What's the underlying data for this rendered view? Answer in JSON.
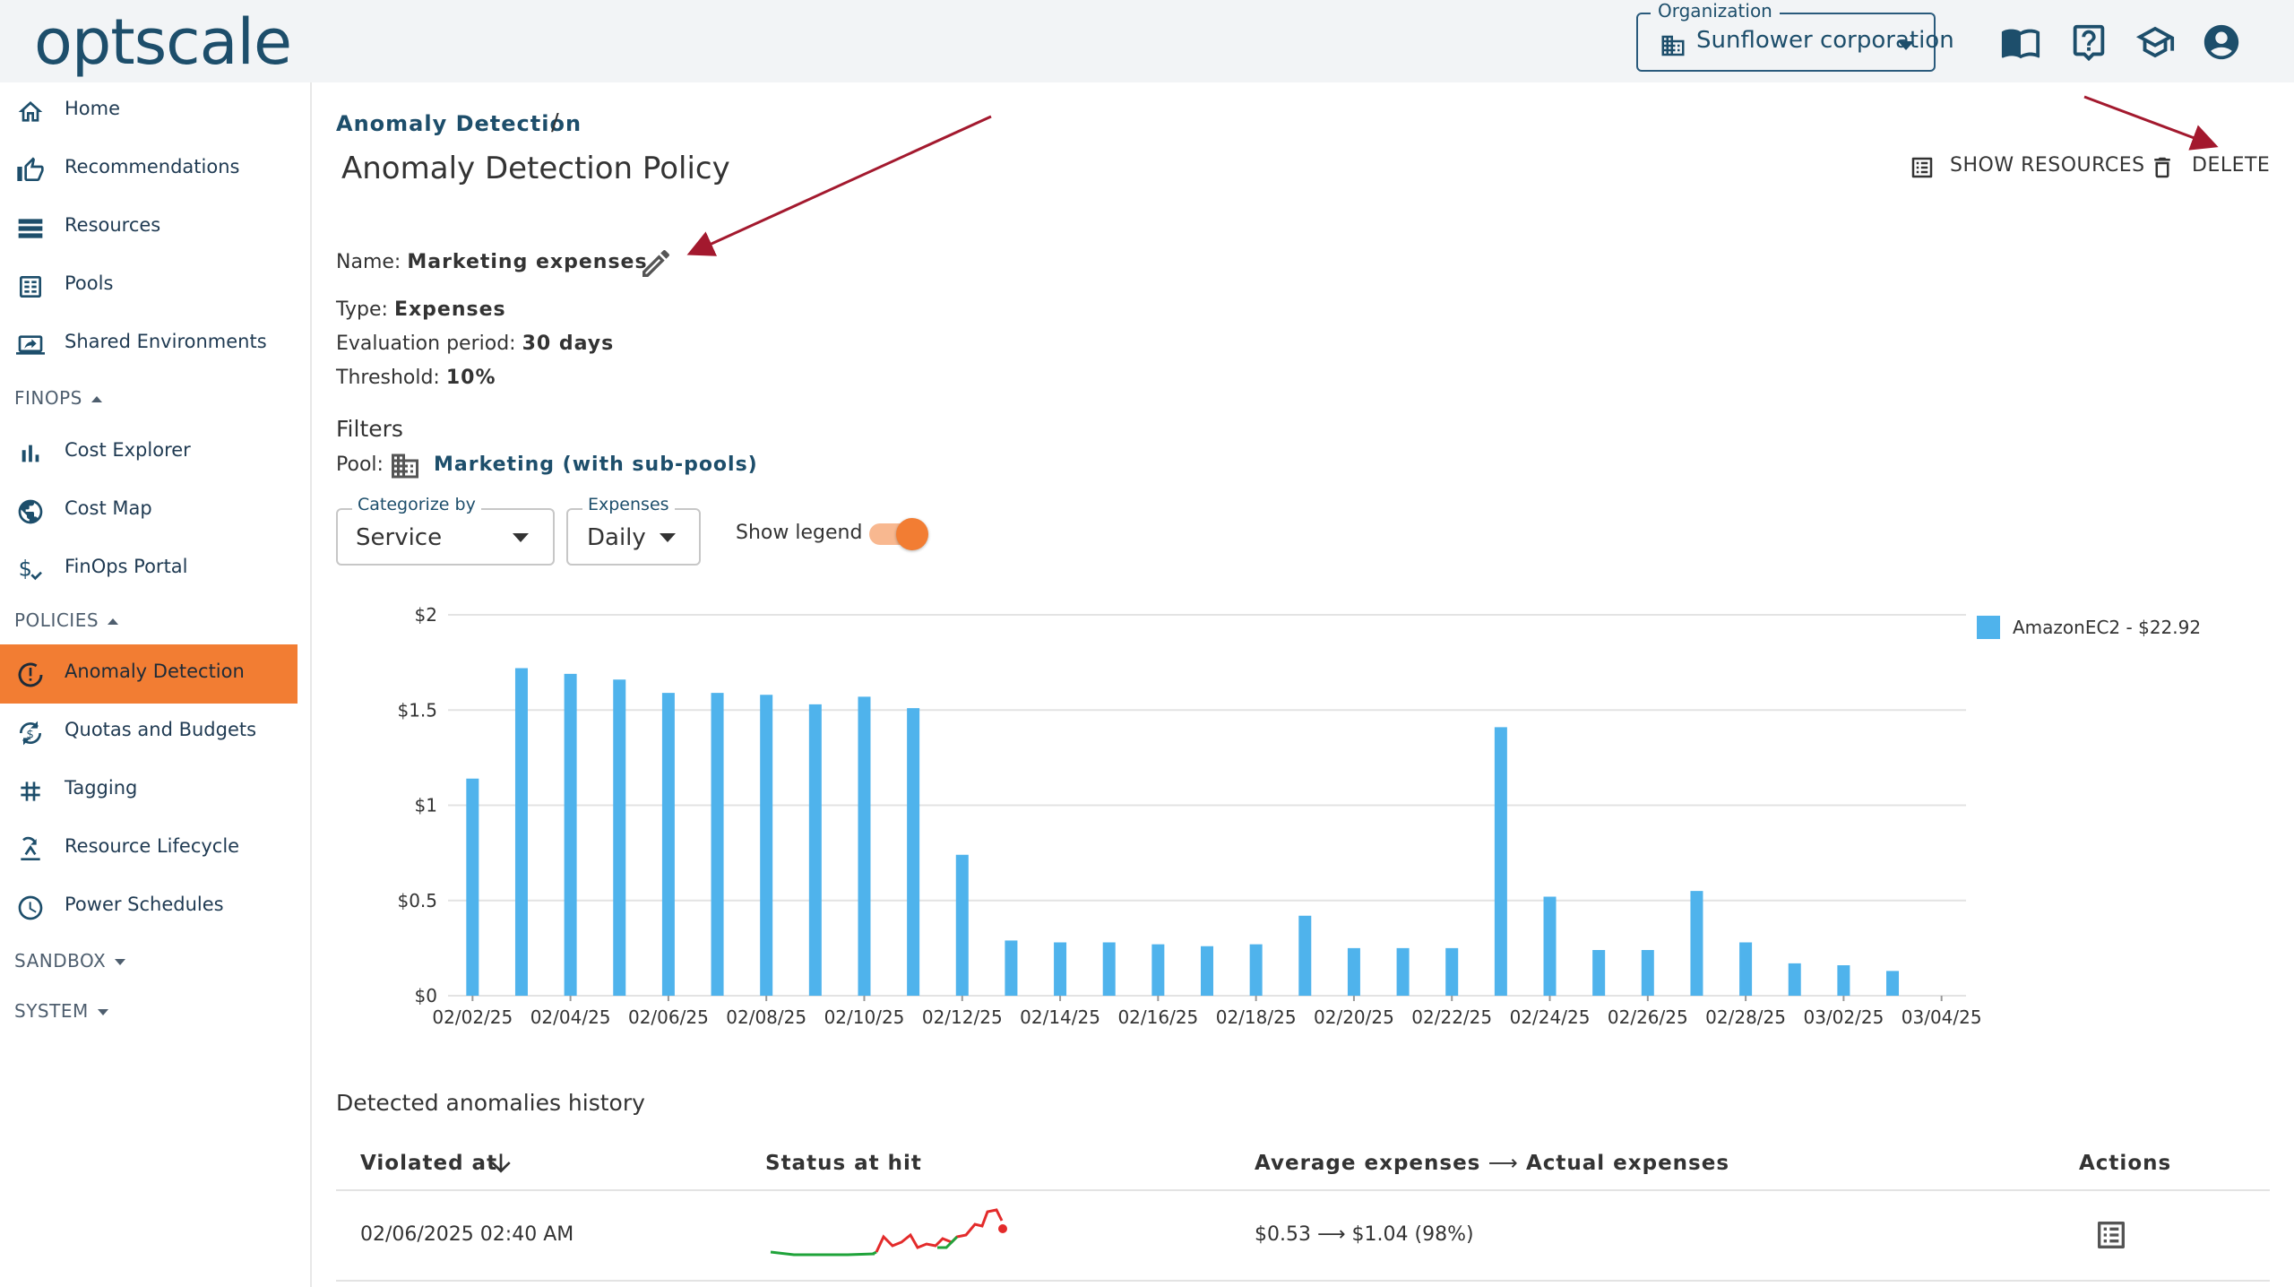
{
  "header": {
    "logo_text": "optscale",
    "org_label": "Organization",
    "org_value": "Sunflower corporation",
    "icons": [
      "documentation-icon",
      "help-icon",
      "training-icon",
      "profile-icon"
    ]
  },
  "sidebar": {
    "items_top": [
      {
        "label": "Home",
        "icon": "home-icon"
      },
      {
        "label": "Recommendations",
        "icon": "thumb-up-icon"
      },
      {
        "label": "Resources",
        "icon": "resources-icon"
      },
      {
        "label": "Pools",
        "icon": "pools-icon"
      },
      {
        "label": "Shared Environments",
        "icon": "shared-env-icon"
      }
    ],
    "finops_label": "FINOPS",
    "finops_items": [
      {
        "label": "Cost Explorer",
        "icon": "bar-chart-icon"
      },
      {
        "label": "Cost Map",
        "icon": "globe-icon"
      },
      {
        "label": "FinOps Portal",
        "icon": "dollar-icon"
      }
    ],
    "policies_label": "POLICIES",
    "policies_items": [
      {
        "label": "Anomaly Detection",
        "icon": "anomaly-icon"
      },
      {
        "label": "Quotas and Budgets",
        "icon": "budget-icon"
      },
      {
        "label": "Tagging",
        "icon": "hash-icon"
      },
      {
        "label": "Resource Lifecycle",
        "icon": "lifecycle-icon"
      },
      {
        "label": "Power Schedules",
        "icon": "clock-icon"
      }
    ],
    "sandbox_label": "SANDBOX",
    "system_label": "SYSTEM"
  },
  "breadcrumb": {
    "link": "Anomaly Detection",
    "sep": "/"
  },
  "page_title": "Anomaly Detection Policy",
  "actions": {
    "show_resources": "SHOW RESOURCES",
    "delete": "DELETE"
  },
  "policy": {
    "name_label": "Name:",
    "name_value": "Marketing expenses",
    "type_label": "Type:",
    "type_value": "Expenses",
    "period_label": "Evaluation period:",
    "period_value": "30 days",
    "threshold_label": "Threshold:",
    "threshold_value": "10%"
  },
  "filters": {
    "title": "Filters",
    "pool_label": "Pool:",
    "pool_value": "Marketing (with sub-pools)"
  },
  "controls": {
    "categorize_label": "Categorize by",
    "categorize_value": "Service",
    "expenses_label": "Expenses",
    "expenses_value": "Daily",
    "legend_label": "Show legend",
    "legend_on": true
  },
  "chart_data": {
    "type": "bar",
    "categories": [
      "02/02/25",
      "02/03/25",
      "02/04/25",
      "02/05/25",
      "02/06/25",
      "02/07/25",
      "02/08/25",
      "02/09/25",
      "02/10/25",
      "02/11/25",
      "02/12/25",
      "02/13/25",
      "02/14/25",
      "02/15/25",
      "02/16/25",
      "02/17/25",
      "02/18/25",
      "02/19/25",
      "02/20/25",
      "02/21/25",
      "02/22/25",
      "02/23/25",
      "02/24/25",
      "02/25/25",
      "02/26/25",
      "02/27/25",
      "02/28/25",
      "03/01/25",
      "03/02/25",
      "03/03/25",
      "03/04/25"
    ],
    "x_tick_labels": [
      "02/02/25",
      "02/04/25",
      "02/06/25",
      "02/08/25",
      "02/10/25",
      "02/12/25",
      "02/14/25",
      "02/16/25",
      "02/18/25",
      "02/20/25",
      "02/22/25",
      "02/24/25",
      "02/26/25",
      "02/28/25",
      "03/02/25",
      "03/04/25"
    ],
    "series": [
      {
        "name": "AmazonEC2 - $22.92",
        "color": "#4fb3ec",
        "values": [
          1.14,
          1.72,
          1.69,
          1.66,
          1.59,
          1.59,
          1.58,
          1.53,
          1.57,
          1.51,
          0.74,
          0.29,
          0.28,
          0.28,
          0.27,
          0.26,
          0.27,
          0.42,
          0.25,
          0.25,
          0.25,
          1.41,
          0.52,
          0.24,
          0.24,
          0.55,
          0.28,
          0.17,
          0.16,
          0.13,
          0
        ]
      }
    ],
    "y_ticks": [
      "$0",
      "$0.5",
      "$1",
      "$1.5",
      "$2"
    ],
    "ylim": [
      0,
      2
    ],
    "legend_position": "top-right",
    "grid": true
  },
  "history": {
    "title": "Detected anomalies history",
    "columns": [
      "Violated at",
      "Status at hit",
      "Average expenses",
      "Actual expenses",
      "Actions"
    ],
    "rows": [
      {
        "violated_at": "02/06/2025 02:40 AM",
        "average": "$0.53",
        "actual": "$1.04 (98%)"
      }
    ]
  }
}
